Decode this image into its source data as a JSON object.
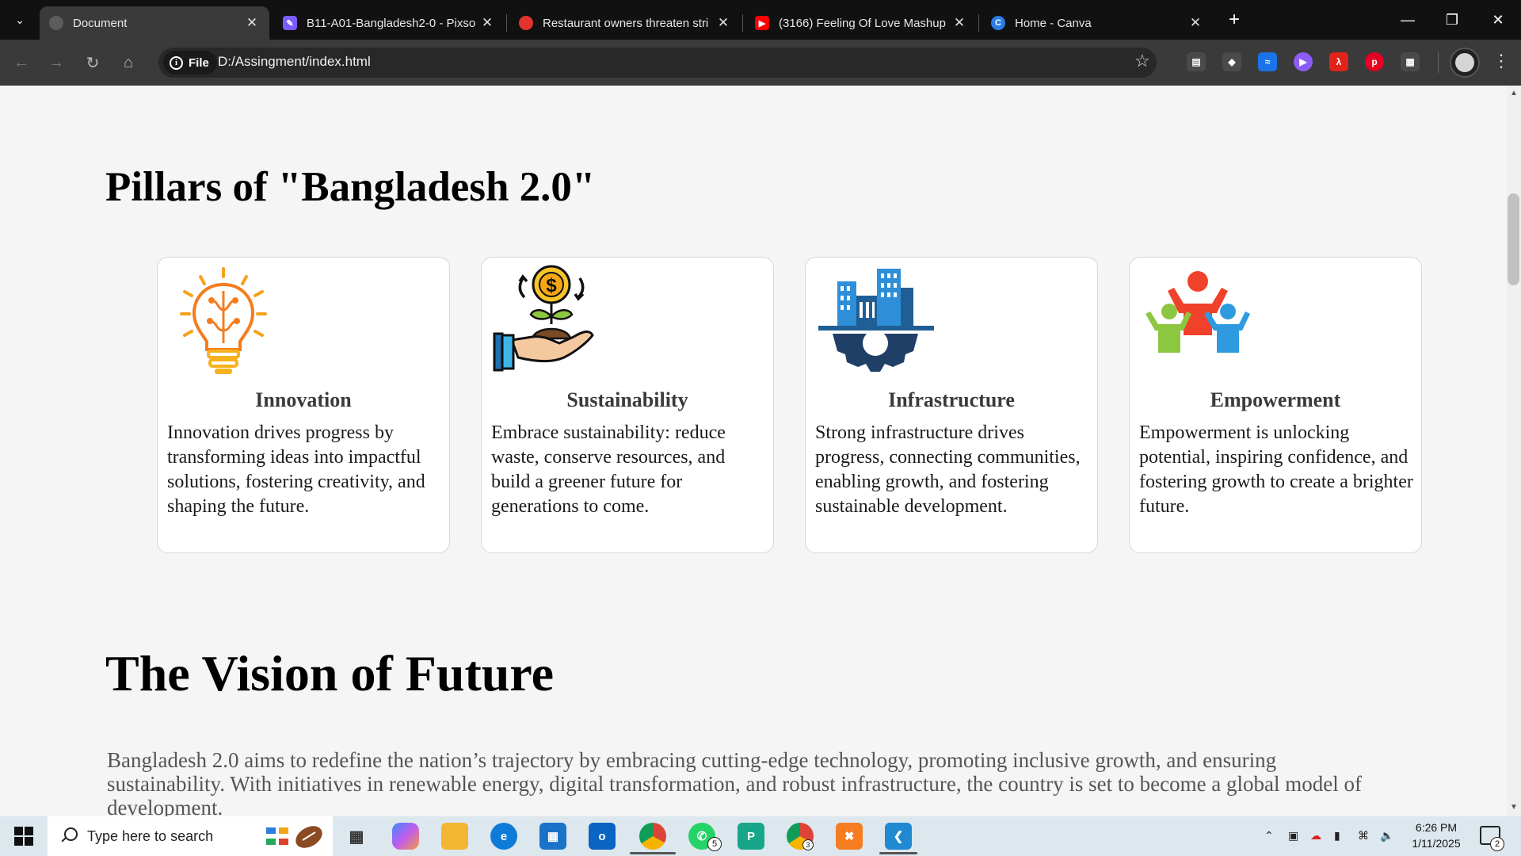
{
  "browser": {
    "tabs": [
      {
        "title": "Document",
        "active": true,
        "icon": "globe-icon",
        "color": "#6b6b6b"
      },
      {
        "title": "B11-A01-Bangladesh2-0 - Pixso",
        "active": false,
        "icon": "pixso-icon",
        "color": "#7b5cff"
      },
      {
        "title": "Restaurant owners threaten stri",
        "active": false,
        "icon": "news-icon",
        "color": "#e2332c"
      },
      {
        "title": "(3166) Feeling Of Love Mashup",
        "active": false,
        "icon": "youtube-icon",
        "color": "#ff0000"
      },
      {
        "title": "Home - Canva",
        "active": false,
        "icon": "canva-icon",
        "color": "#2b7de9"
      }
    ],
    "address": {
      "scheme_label": "File",
      "url": "D:/Assingment/index.html"
    },
    "extensions": [
      {
        "name": "reading-mode-icon",
        "color": "#4a4a4a"
      },
      {
        "name": "translate-extension-icon",
        "color": "#4a4a4a"
      },
      {
        "name": "wave-extension-icon",
        "color": "#1a73e8"
      },
      {
        "name": "player-extension-icon",
        "color": "#8b5cf6"
      },
      {
        "name": "pdf-extension-icon",
        "color": "#e2231a"
      },
      {
        "name": "pinterest-extension-icon",
        "color": "#e60023"
      },
      {
        "name": "puzzle-extensions-icon",
        "color": "#4a4a4a"
      }
    ]
  },
  "page": {
    "pillars_title": "Pillars of \"Bangladesh 2.0\"",
    "cards": [
      {
        "title": "Innovation",
        "body": "Innovation drives progress by transforming ideas into impactful solutions, fostering creativity, and shaping the future.",
        "icon": "lightbulb-brain-icon"
      },
      {
        "title": "Sustainability",
        "body": "Embrace sustainability: reduce waste, conserve resources, and build a greener future for generations to come.",
        "icon": "money-plant-hand-icon"
      },
      {
        "title": "Infrastructure",
        "body": "Strong infrastructure drives progress, connecting communities, enabling growth, and fostering sustainable development.",
        "icon": "city-gear-icon"
      },
      {
        "title": "Empowerment",
        "body": "Empowerment is unlocking potential, inspiring confidence, and fostering growth to create a brighter future.",
        "icon": "people-raised-arms-icon"
      }
    ],
    "vision_title": "The Vision of Future",
    "vision_body": "Bangladesh 2.0 aims to redefine the nation’s trajectory by embracing cutting-edge technology, promoting inclusive growth, and ensuring sustainability. With initiatives in renewable energy, digital transformation, and robust infrastructure, the country is set to become a global model of development."
  },
  "taskbar": {
    "search_placeholder": "Type here to search",
    "apps": [
      {
        "name": "task-view-icon",
        "color": "#333333"
      },
      {
        "name": "copilot-icon",
        "color": "#7a5cf0"
      },
      {
        "name": "file-explorer-icon",
        "color": "#f2b632"
      },
      {
        "name": "edge-icon",
        "color": "#0f7bd8"
      },
      {
        "name": "microsoft-store-icon",
        "color": "#1a73c8"
      },
      {
        "name": "outlook-icon",
        "color": "#0a64c2"
      },
      {
        "name": "chrome-icon",
        "color": "#db4437"
      },
      {
        "name": "whatsapp-icon",
        "color": "#25d366"
      },
      {
        "name": "pycharm-icon",
        "color": "#18a68a"
      },
      {
        "name": "chrome-profile-icon",
        "color": "#db4437"
      },
      {
        "name": "xampp-icon",
        "color": "#f57c20"
      },
      {
        "name": "vscode-icon",
        "color": "#1f8ad2"
      }
    ],
    "whatsapp_badge": "5",
    "chrome_badge": "3",
    "time": "6:26 PM",
    "date": "1/11/2025",
    "notification_count": "2"
  }
}
